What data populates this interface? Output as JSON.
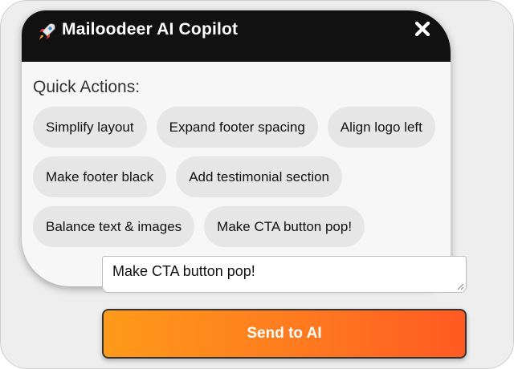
{
  "header": {
    "title": "Mailoodeer AI Copilot",
    "icon": "rocket-icon",
    "close_icon": "close-icon",
    "background": "#111111"
  },
  "quick_actions": {
    "label": "Quick Actions:",
    "rows": [
      [
        "Simplify layout",
        "Expand footer spacing",
        "Align logo left"
      ],
      [
        "Make footer black",
        "Add testimonial section"
      ],
      [
        "Balance text & images",
        "Make CTA button pop!"
      ]
    ]
  },
  "prompt": {
    "value": "Make CTA button pop!"
  },
  "send": {
    "label": "Send to AI",
    "color_start": "#ff9a1a",
    "color_end": "#ff5a22"
  }
}
